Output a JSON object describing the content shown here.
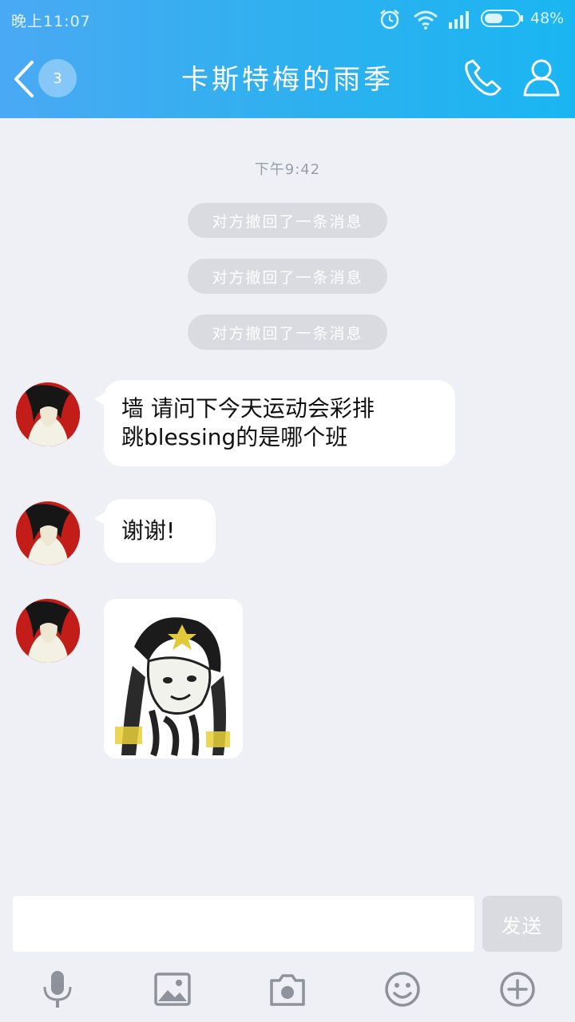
{
  "status_bar": {
    "time": "晚上11:07",
    "battery_pct": "48%",
    "icons": [
      "alarm-icon",
      "wifi-icon",
      "signal-icon",
      "battery-icon"
    ]
  },
  "header": {
    "unread_count": "3",
    "title": "卡斯特梅的雨季",
    "icons": [
      "back-chevron-icon",
      "phone-icon",
      "profile-icon"
    ]
  },
  "chat": {
    "timestamp": "下午9:42",
    "recalled": [
      "对方撤回了一条消息",
      "对方撤回了一条消息",
      "对方撤回了一条消息"
    ],
    "messages": [
      {
        "line1": "墙 请问下今天运动会彩排",
        "line2": "跳blessing的是哪个班"
      },
      {
        "text": "谢谢!"
      }
    ]
  },
  "input_bar": {
    "value": "",
    "send_label": "发送",
    "tools": [
      "microphone-icon",
      "image-icon",
      "camera-icon",
      "emoji-icon",
      "plus-icon"
    ]
  },
  "colors": {
    "header_start": "#4aa9f4",
    "header_end": "#1ab6f2",
    "background": "#eef0f6",
    "recall_pill": "#d9dbe0"
  }
}
